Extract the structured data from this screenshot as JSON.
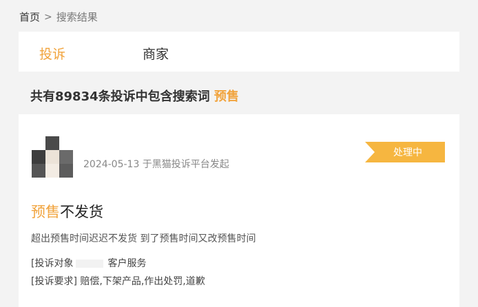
{
  "breadcrumb": {
    "home": "首页",
    "separator": ">",
    "current": "搜索结果"
  },
  "tabs": [
    {
      "label": "投诉"
    },
    {
      "label": "商家"
    }
  ],
  "summary": {
    "prefix": "共有89834条投诉中包含搜索词",
    "keyword": "预售"
  },
  "complaint": {
    "date_line": "2024-05-13 于黑猫投诉平台发起",
    "status": "处理中",
    "title_keyword": "预售",
    "title_rest": "不发货",
    "description": "超出预售时间迟迟不发货 到了预售时间又改预售时间",
    "target_label": "[投诉对象",
    "target_value": "客户服务",
    "request_label": "[投诉要求]",
    "request_value": "赔偿,下架产品,作出处罚,道歉"
  },
  "colors": {
    "accent": "#f1a33c",
    "status_bg": "#f6b640"
  }
}
